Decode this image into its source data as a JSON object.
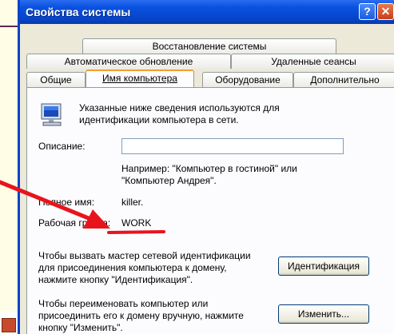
{
  "window": {
    "title": "Свойства системы",
    "help_glyph": "?",
    "close_glyph": "✕"
  },
  "tabs": {
    "row1": [
      "Восстановление системы"
    ],
    "row2": [
      "Автоматическое обновление",
      "Удаленные сеансы"
    ],
    "row3": [
      "Общие",
      "Имя компьютера",
      "Оборудование",
      "Дополнительно"
    ],
    "active": "Имя компьютера"
  },
  "panel": {
    "intro_line1": "Указанные ниже сведения используются для",
    "intro_line2": "идентификации компьютера в сети.",
    "description_label": "Описание:",
    "description_value": "",
    "example_line1": "Например: \"Компьютер в гостиной\" или",
    "example_line2": "\"Компьютер Андрея\".",
    "fullname_label": "Полное имя:",
    "fullname_value": "killer.",
    "workgroup_label": "Рабочая группа:",
    "workgroup_value": "WORK",
    "wizard_line1": "Чтобы вызвать мастер сетевой идентификации",
    "wizard_line2": "для присоединения компьютера к домену,",
    "wizard_line3": "нажмите кнопку \"Идентификация\".",
    "identify_button": "Идентификация",
    "rename_line1": "Чтобы переименовать компьютер или",
    "rename_line2": "присоединить его к домену вручную, нажмите",
    "rename_line3": "кнопку \"Изменить\".",
    "change_button": "Изменить..."
  },
  "colors": {
    "titlebar": "#0a52e0",
    "annotation_arrow": "#e8141c"
  }
}
